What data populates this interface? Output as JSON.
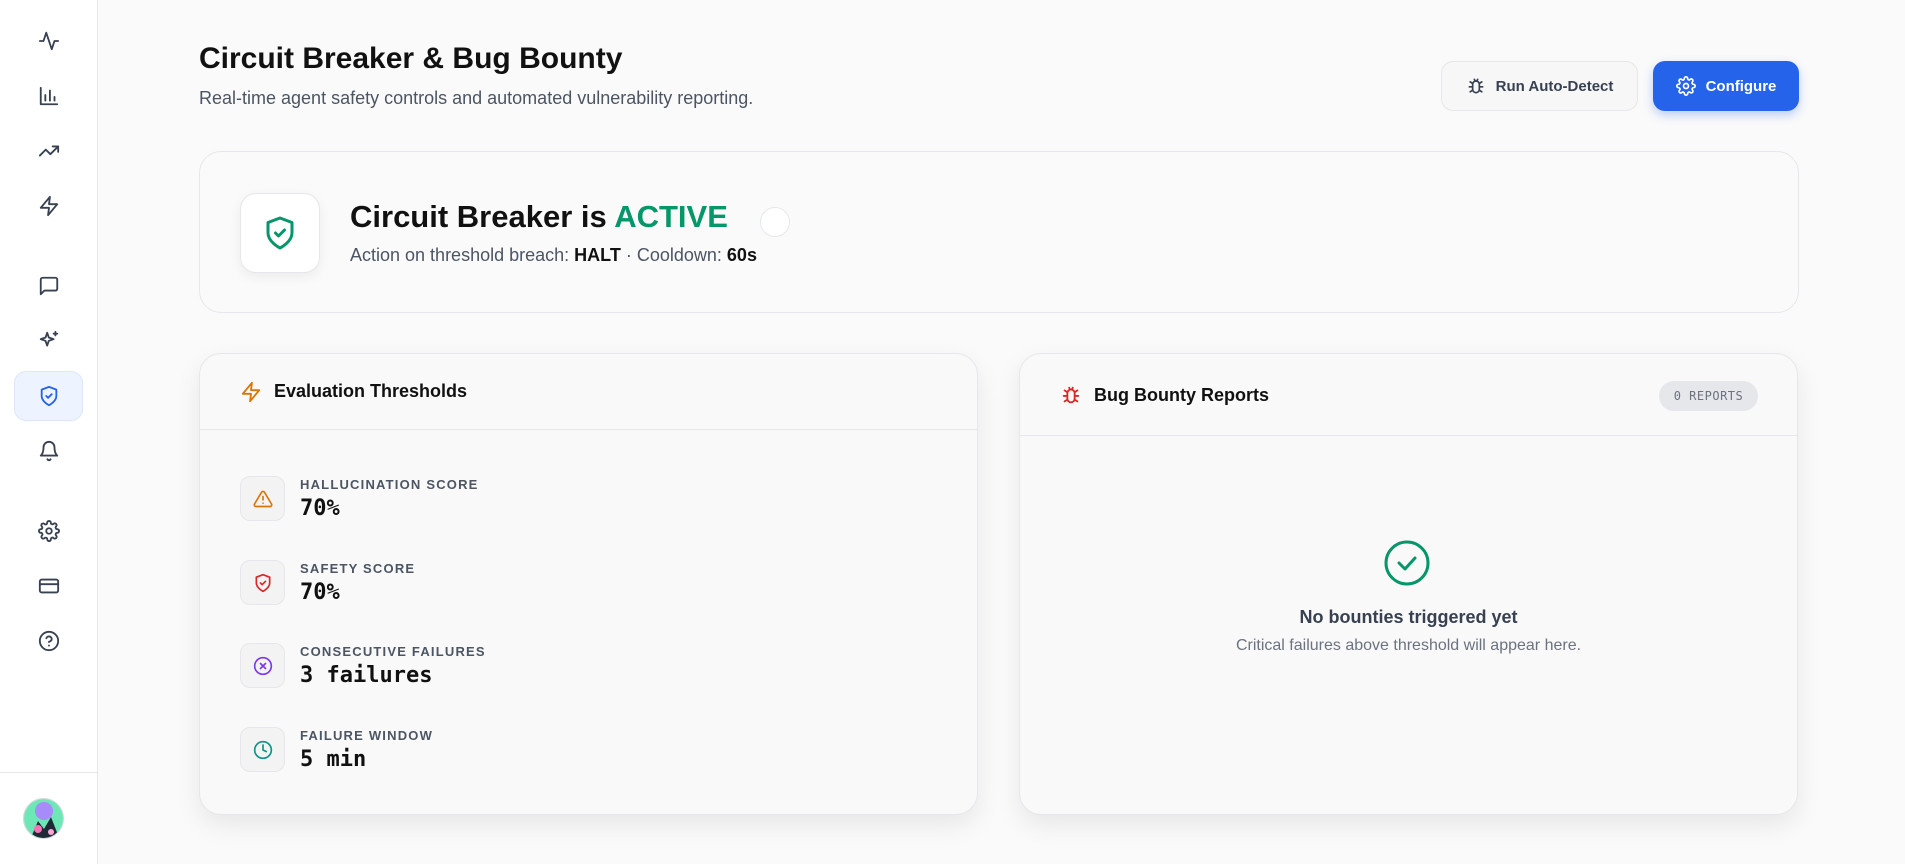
{
  "header": {
    "title": "Circuit Breaker & Bug Bounty",
    "subtitle": "Real-time agent safety controls and automated vulnerability reporting."
  },
  "actions": {
    "autodetect_label": "Run Auto-Detect",
    "configure_label": "Configure"
  },
  "sidebar": {
    "items": [
      {
        "icon": "activity-icon"
      },
      {
        "icon": "bar-chart-icon"
      },
      {
        "icon": "trending-up-icon"
      },
      {
        "icon": "zap-icon"
      },
      {
        "icon": "message-icon"
      },
      {
        "icon": "sparkles-icon"
      },
      {
        "icon": "shield-check-icon",
        "active": true
      },
      {
        "icon": "bell-icon"
      },
      {
        "icon": "settings-icon"
      },
      {
        "icon": "credit-card-icon"
      },
      {
        "icon": "help-circle-icon"
      }
    ]
  },
  "status": {
    "title_prefix": "Circuit Breaker is",
    "state": "ACTIVE",
    "action_label": "Action on threshold breach:",
    "action_value": "HALT",
    "separator": "·",
    "cooldown_label": "Cooldown:",
    "cooldown_value": "60s"
  },
  "thresholds": {
    "title": "Evaluation Thresholds",
    "items": [
      {
        "label": "HALLUCINATION SCORE",
        "value": "70%",
        "icon": "alert-triangle-icon",
        "color": "#d97706"
      },
      {
        "label": "SAFETY SCORE",
        "value": "70%",
        "icon": "shield-icon",
        "color": "#dc2626"
      },
      {
        "label": "CONSECUTIVE FAILURES",
        "value": "3 failures",
        "icon": "x-circle-icon",
        "color": "#7c3aed"
      },
      {
        "label": "FAILURE WINDOW",
        "value": "5 min",
        "icon": "clock-icon",
        "color": "#0d9488"
      }
    ]
  },
  "bounty": {
    "title": "Bug Bounty Reports",
    "badge": "0 REPORTS",
    "empty_title": "No bounties triggered yet",
    "empty_subtitle": "Critical failures above threshold will appear here."
  },
  "colors": {
    "accent": "#2563eb",
    "active": "#059669"
  }
}
